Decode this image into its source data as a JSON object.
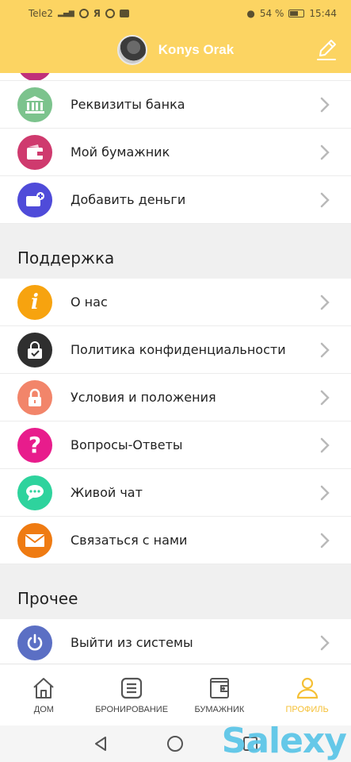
{
  "status_bar": {
    "carrier": "Tele2",
    "battery_percent": "54 %",
    "time": "15:44"
  },
  "header": {
    "user_name": "Konys Orak",
    "edit_icon": "pencil-square-icon"
  },
  "account_items": [
    {
      "label": "Реквизиты банка",
      "icon": "bank-icon",
      "color": "#7cc38d"
    },
    {
      "label": "Мой бумажник",
      "icon": "wallet-icon",
      "color": "#cf3a6e"
    },
    {
      "label": "Добавить деньги",
      "icon": "add-money-icon",
      "color": "#4f4bd9"
    }
  ],
  "support": {
    "title": "Поддержка",
    "items": [
      {
        "label": "О нас",
        "icon": "info-icon",
        "color": "#f7a30f"
      },
      {
        "label": "Политика конфиденциальности",
        "icon": "privacy-lock-icon",
        "color": "#2f2f2f"
      },
      {
        "label": "Условия и положения",
        "icon": "lock-icon",
        "color": "#f2856a"
      },
      {
        "label": "Вопросы-Ответы",
        "icon": "question-icon",
        "color": "#e81c8c"
      },
      {
        "label": "Живой чат",
        "icon": "chat-icon",
        "color": "#2ed39d"
      },
      {
        "label": "Связаться с нами",
        "icon": "mail-icon",
        "color": "#ef7b12"
      }
    ]
  },
  "other": {
    "title": "Прочее",
    "items": [
      {
        "label": "Выйти из системы",
        "icon": "power-icon",
        "color": "#5b6fc4"
      }
    ]
  },
  "bottom_nav": [
    {
      "label": "ДОМ",
      "icon": "home-icon",
      "active": false
    },
    {
      "label": "БРОНИРОВАНИЕ",
      "icon": "list-icon",
      "active": false
    },
    {
      "label": "БУМАЖНИК",
      "icon": "wallet-outline-icon",
      "active": false
    },
    {
      "label": "ПРОФИЛЬ",
      "icon": "profile-icon",
      "active": true
    }
  ],
  "watermark": "Salexy",
  "colors": {
    "accent": "#fcd462",
    "active_nav": "#f5c036"
  }
}
